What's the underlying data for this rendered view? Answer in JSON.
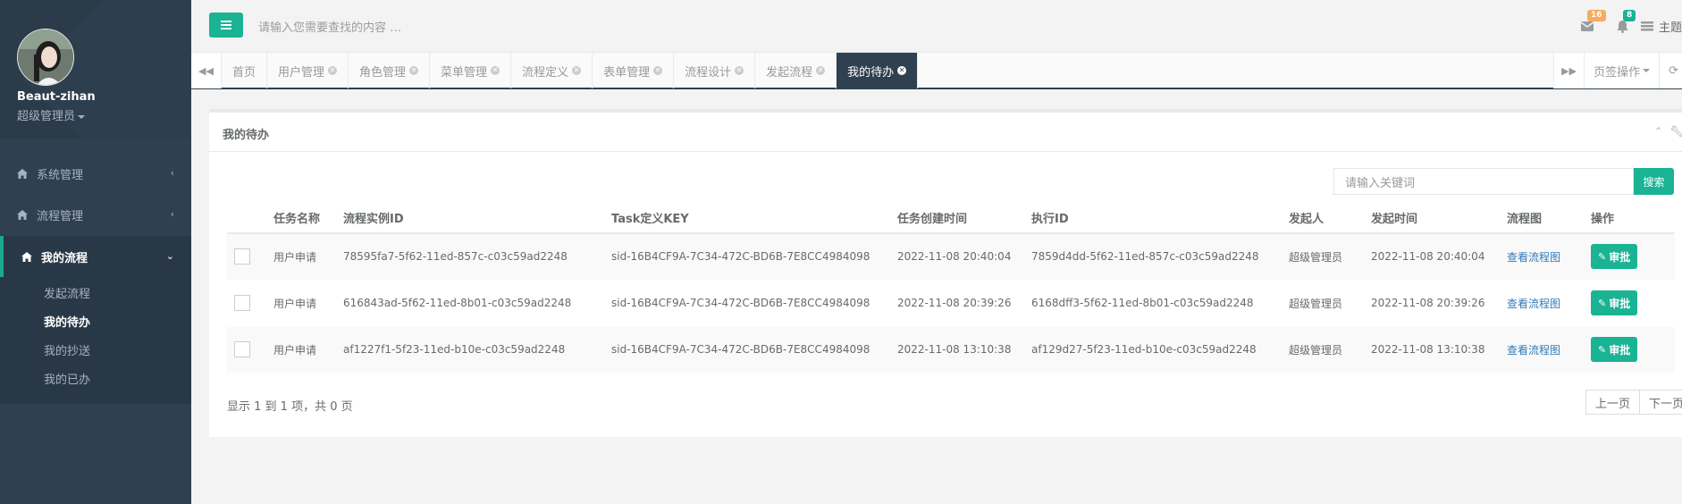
{
  "sidebar": {
    "user_name": "Beaut-zihan",
    "user_role": "超级管理员",
    "menu": [
      {
        "label": "系统管理",
        "icon": "home-icon"
      },
      {
        "label": "流程管理",
        "icon": "home-icon"
      },
      {
        "label": "我的流程",
        "icon": "home-icon"
      }
    ],
    "submenu": [
      "发起流程",
      "我的待办",
      "我的抄送",
      "我的已办"
    ]
  },
  "topbar": {
    "search_placeholder": "请输入您需要查找的内容 …",
    "mail_count": "16",
    "bell_count": "8",
    "theme_label": "主题"
  },
  "tabs": [
    "首页",
    "用户管理",
    "角色管理",
    "菜单管理",
    "流程定义",
    "表单管理",
    "流程设计",
    "发起流程",
    "我的待办"
  ],
  "tab_actions": {
    "page_ops": "页签操作"
  },
  "panel": {
    "title": "我的待办",
    "keyword_placeholder": "请输入关键词",
    "search_label": "搜索",
    "columns": [
      "任务名称",
      "流程实例ID",
      "Task定义KEY",
      "任务创建时间",
      "执行ID",
      "发起人",
      "发起时间",
      "流程图",
      "操作"
    ],
    "rows": [
      {
        "name": "用户申请",
        "instance_id": "78595fa7-5f62-11ed-857c-c03c59ad2248",
        "task_key": "sid-16B4CF9A-7C34-472C-BD6B-7E8CC4984098",
        "created": "2022-11-08 20:40:04",
        "exec_id": "7859d4dd-5f62-11ed-857c-c03c59ad2248",
        "starter": "超级管理员",
        "start_time": "2022-11-08 20:40:04",
        "diagram": "查看流程图",
        "action": "审批"
      },
      {
        "name": "用户申请",
        "instance_id": "616843ad-5f62-11ed-8b01-c03c59ad2248",
        "task_key": "sid-16B4CF9A-7C34-472C-BD6B-7E8CC4984098",
        "created": "2022-11-08 20:39:26",
        "exec_id": "6168dff3-5f62-11ed-8b01-c03c59ad2248",
        "starter": "超级管理员",
        "start_time": "2022-11-08 20:39:26",
        "diagram": "查看流程图",
        "action": "审批"
      },
      {
        "name": "用户申请",
        "instance_id": "af1227f1-5f23-11ed-b10e-c03c59ad2248",
        "task_key": "sid-16B4CF9A-7C34-472C-BD6B-7E8CC4984098",
        "created": "2022-11-08 13:10:38",
        "exec_id": "af129d27-5f23-11ed-b10e-c03c59ad2248",
        "starter": "超级管理员",
        "start_time": "2022-11-08 13:10:38",
        "diagram": "查看流程图",
        "action": "审批"
      }
    ],
    "pager_info": "显示 1 到 1 项，共 0 页",
    "prev_label": "上一页",
    "next_label": "下一页"
  }
}
